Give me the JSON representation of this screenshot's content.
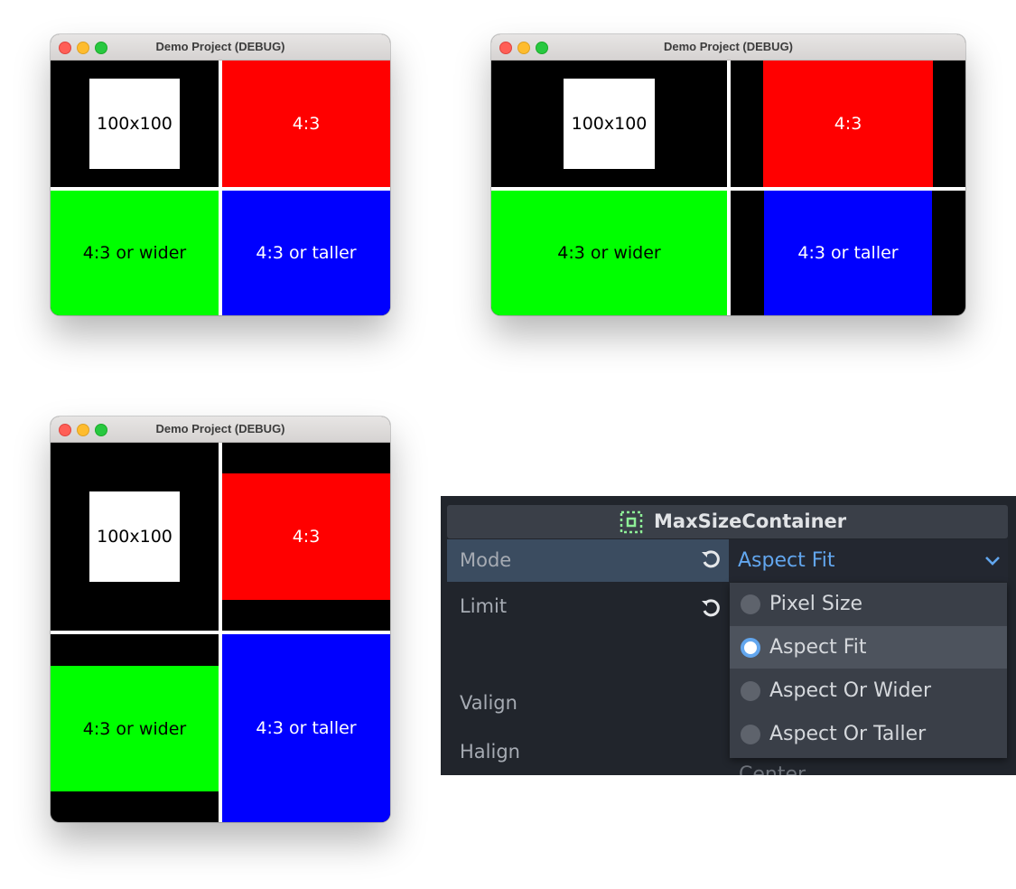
{
  "windows": [
    {
      "title": "Demo Project (DEBUG)",
      "cells": [
        "100x100",
        "4:3",
        "4:3 or wider",
        "4:3 or taller"
      ]
    },
    {
      "title": "Demo Project (DEBUG)",
      "cells": [
        "100x100",
        "4:3",
        "4:3 or wider",
        "4:3 or taller"
      ]
    },
    {
      "title": "Demo Project (DEBUG)",
      "cells": [
        "100x100",
        "4:3",
        "4:3 or wider",
        "4:3 or taller"
      ]
    }
  ],
  "colors": {
    "square": "#ffffff",
    "aspect": "#ff0000",
    "wider": "#00ff00",
    "taller": "#0000ff",
    "accent": "#62a6ee"
  },
  "inspector": {
    "header": {
      "title": "MaxSizeContainer",
      "icon": "max-size-container-icon"
    },
    "properties": [
      {
        "label": "Mode",
        "value": "Aspect Fit"
      },
      {
        "label": "Limit"
      },
      {
        "label": "Valign"
      },
      {
        "label": "Halign"
      }
    ],
    "dropdown": {
      "options": [
        "Pixel Size",
        "Aspect Fit",
        "Aspect Or Wider",
        "Aspect Or Taller"
      ],
      "selected": "Aspect Fit"
    },
    "partially_hidden_value": "Center"
  }
}
